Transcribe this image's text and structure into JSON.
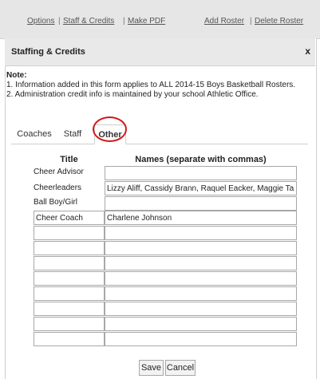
{
  "toolbar": {
    "options": "Options",
    "sep1": "|",
    "staff_credits": "Staff & Credits",
    "sep2": "|",
    "make_pdf": "Make PDF",
    "add_roster": "Add Roster",
    "sep3": "|",
    "delete_roster": "Delete Roster"
  },
  "dialog": {
    "title": "Staffing & Credits",
    "close": "x",
    "note_heading": "Note:",
    "note_1": "1. Information added in this form applies to ALL 2014-15 Boys Basketball Rosters.",
    "note_2": "2. Administration credit info is maintained by your school Athletic Office."
  },
  "tabs": [
    "Coaches",
    "Staff",
    "Other"
  ],
  "active_tab": "Other",
  "table": {
    "col_title": "Title",
    "col_names": "Names (separate with commas)",
    "fixed_rows": [
      {
        "title": "Cheer Advisor",
        "names": ""
      },
      {
        "title": "Cheerleaders",
        "names": "Lizzy Aliff, Cassidy Brann, Raquel Eacker, Maggie Tartios,"
      },
      {
        "title": "Ball Boy/Girl",
        "names": ""
      }
    ],
    "editable_rows": [
      {
        "title": "Cheer Coach",
        "names": "Charlene Johnson"
      },
      {
        "title": "",
        "names": ""
      },
      {
        "title": "",
        "names": ""
      },
      {
        "title": "",
        "names": ""
      },
      {
        "title": "",
        "names": ""
      },
      {
        "title": "",
        "names": ""
      },
      {
        "title": "",
        "names": ""
      },
      {
        "title": "",
        "names": ""
      },
      {
        "title": "",
        "names": ""
      },
      {
        "title": "",
        "names": ""
      }
    ]
  },
  "buttons": {
    "save": "Save",
    "cancel": "Cancel"
  },
  "colors": {
    "annotation_circle": "#d11a1a",
    "header_bg": "#e9e9e9"
  }
}
